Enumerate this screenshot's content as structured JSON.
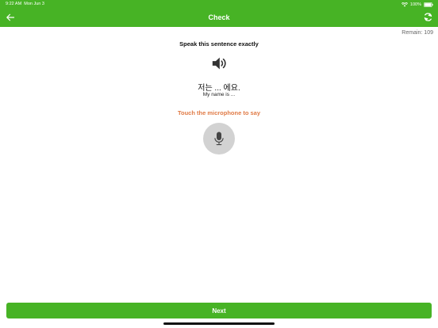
{
  "status_bar": {
    "time": "9:22 AM",
    "date": "Mon Jun 3",
    "battery": "100%"
  },
  "header": {
    "title": "Check",
    "back_icon": "arrow-left-icon",
    "refresh_icon": "refresh-icon",
    "background_color": "#47b325"
  },
  "remain_label": "Remain: 109",
  "instruction": "Speak this sentence exactly",
  "sentence": {
    "text": "저는 ... 에요.",
    "translation": "My name is ..."
  },
  "speaker_icon": "speaker-icon",
  "mic": {
    "prompt": "Touch the microphone to say",
    "icon": "microphone-icon",
    "prompt_color": "#e07a45"
  },
  "next_button": {
    "label": "Next"
  }
}
